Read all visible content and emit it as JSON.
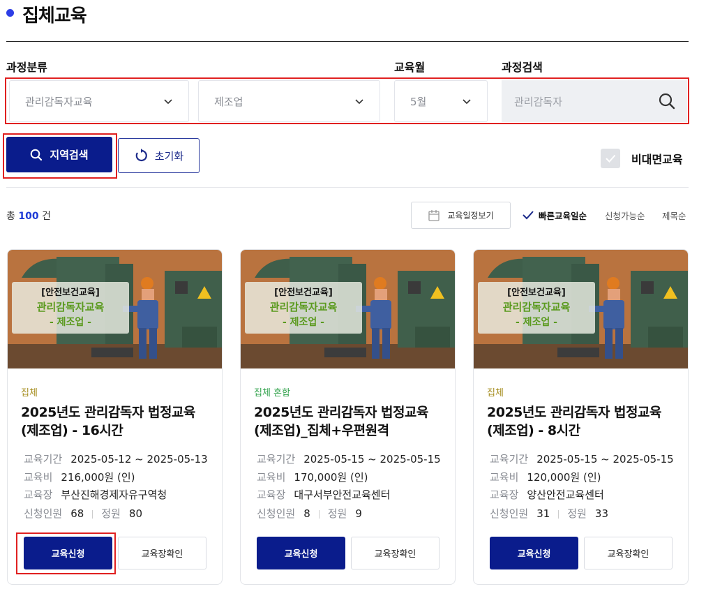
{
  "page": {
    "title": "집체교육"
  },
  "filters": {
    "category_label": "과정분류",
    "month_label": "교육월",
    "search_label": "과정검색",
    "category_value": "관리감독자교육",
    "industry_value": "제조업",
    "month_value": "5월",
    "search_value": "관리감독자"
  },
  "actions": {
    "region_search": "지역검색",
    "reset": "초기화",
    "offline_label": "비대면교육"
  },
  "results": {
    "total_prefix": "총",
    "total_count": "100",
    "total_suffix": "건",
    "calendar_button": "교육일정보기",
    "sort_options": [
      "빠른교육일순",
      "신청가능순",
      "제목순"
    ],
    "sort_active": 0
  },
  "card_labels": {
    "period": "교육기간",
    "fee": "교육비",
    "venue": "교육장",
    "applicants": "신청인원",
    "capacity": "정원",
    "apply_button": "교육신청",
    "venue_button": "교육장확인"
  },
  "cards": [
    {
      "banner_tag": "[안전보건교육]",
      "banner_course": "관리감독자교육",
      "banner_industry": "- 제조업 -",
      "type": "집체",
      "title_line1": "2025년도 관리감독자 법정교육",
      "title_line2": "(제조업) - 16시간",
      "period": "2025-05-12 ~ 2025-05-13",
      "fee": "216,000원 (인)",
      "venue": "부산진해경제자유구역청",
      "applicants": "68",
      "capacity": "80"
    },
    {
      "banner_tag": "[안전보건교육]",
      "banner_course": "관리감독자교육",
      "banner_industry": "- 제조업 -",
      "type": "집체 혼합",
      "title_line1": "2025년도 관리감독자 법정교육",
      "title_line2": "(제조업)_집체+우편원격",
      "period": "2025-05-15 ~ 2025-05-15",
      "fee": "170,000원 (인)",
      "venue": "대구서부안전교육센터",
      "applicants": "8",
      "capacity": "9"
    },
    {
      "banner_tag": "[안전보건교육]",
      "banner_course": "관리감독자교육",
      "banner_industry": "- 제조업 -",
      "type": "집체",
      "title_line1": "2025년도 관리감독자 법정교육",
      "title_line2": "(제조업) - 8시간",
      "period": "2025-05-15 ~ 2025-05-15",
      "fee": "120,000원 (인)",
      "venue": "양산안전교육센터",
      "applicants": "31",
      "capacity": "33"
    }
  ],
  "colors": {
    "accent": "#0a1c8c",
    "title_dot": "#2d3ee6",
    "type_individual": "#a38b1a",
    "type_mixed": "#2fa14a",
    "highlight_border": "#e02020"
  },
  "icons": [
    "search-icon",
    "chevron-down-icon",
    "refresh-icon",
    "calendar-icon",
    "check-icon"
  ]
}
